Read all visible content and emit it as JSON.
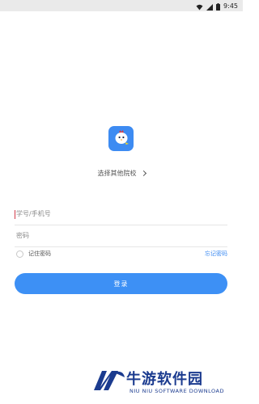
{
  "status_bar": {
    "time": "9:45",
    "icons": [
      "wifi-icon",
      "signal-icon",
      "battery-icon"
    ]
  },
  "app": {
    "logo_icon": "chick-logo-icon",
    "accent_color": "#3d8bf2"
  },
  "school_selector": {
    "label": "选择其他院校",
    "icon": "chevron-right-icon"
  },
  "login_form": {
    "account": {
      "value": "",
      "placeholder": "学号/手机号"
    },
    "password": {
      "value": "",
      "placeholder": "密码"
    },
    "remember": {
      "label": "记住密码",
      "checked": false
    },
    "forgot_label": "忘记密码",
    "submit_label": "登录"
  },
  "watermark": {
    "name": "牛游软件园",
    "subtitle": "NIU NIU SOFTWARE DOWNLOAD"
  }
}
